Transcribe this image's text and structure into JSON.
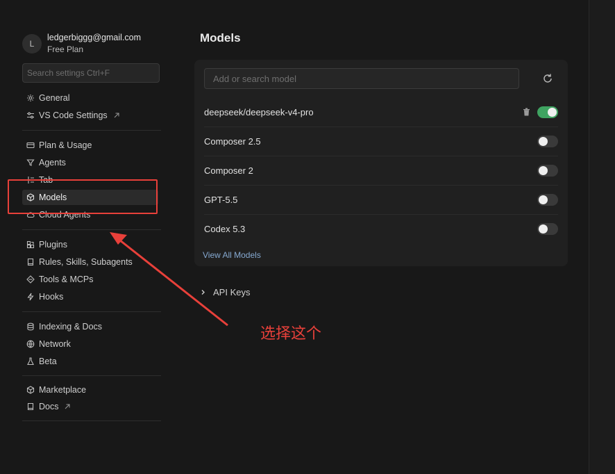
{
  "user": {
    "avatar_letter": "L",
    "email": "ledgerbiggg@gmail.com",
    "plan": "Free Plan"
  },
  "search": {
    "placeholder": "Search settings Ctrl+F"
  },
  "sidebar": {
    "items": [
      {
        "label": "General",
        "icon": "gear-icon"
      },
      {
        "label": "VS Code Settings",
        "icon": "sliders-icon",
        "external": true
      },
      {
        "label": "Plan & Usage",
        "icon": "card-icon"
      },
      {
        "label": "Agents",
        "icon": "funnel-icon"
      },
      {
        "label": "Tab",
        "icon": "tab-icon"
      },
      {
        "label": "Models",
        "icon": "cube-icon",
        "active": true
      },
      {
        "label": "Cloud Agents",
        "icon": "cloud-icon"
      },
      {
        "label": "Plugins",
        "icon": "puzzle-icon"
      },
      {
        "label": "Rules, Skills, Subagents",
        "icon": "book-icon"
      },
      {
        "label": "Tools & MCPs",
        "icon": "diamond-icon"
      },
      {
        "label": "Hooks",
        "icon": "bolt-icon"
      },
      {
        "label": "Indexing & Docs",
        "icon": "database-icon"
      },
      {
        "label": "Network",
        "icon": "globe-icon"
      },
      {
        "label": "Beta",
        "icon": "flask-icon"
      },
      {
        "label": "Marketplace",
        "icon": "cube-icon"
      },
      {
        "label": "Docs",
        "icon": "book-icon",
        "external": true
      }
    ]
  },
  "main": {
    "title": "Models",
    "model_search_placeholder": "Add or search model",
    "refresh_icon": "refresh-icon",
    "models": [
      {
        "name": "deepseek/deepseek-v4-pro",
        "enabled": true,
        "deletable": true
      },
      {
        "name": "Composer 2.5",
        "enabled": false
      },
      {
        "name": "Composer 2",
        "enabled": false
      },
      {
        "name": "GPT-5.5",
        "enabled": false
      },
      {
        "name": "Codex 5.3",
        "enabled": false
      }
    ],
    "view_all_label": "View All Models",
    "api_keys_label": "API Keys"
  },
  "annotation": {
    "text": "选择这个",
    "color": "#e8403a"
  },
  "colors": {
    "background": "#181818",
    "card": "#202020",
    "toggle_on": "#3fa361",
    "link": "#86a9d1"
  }
}
